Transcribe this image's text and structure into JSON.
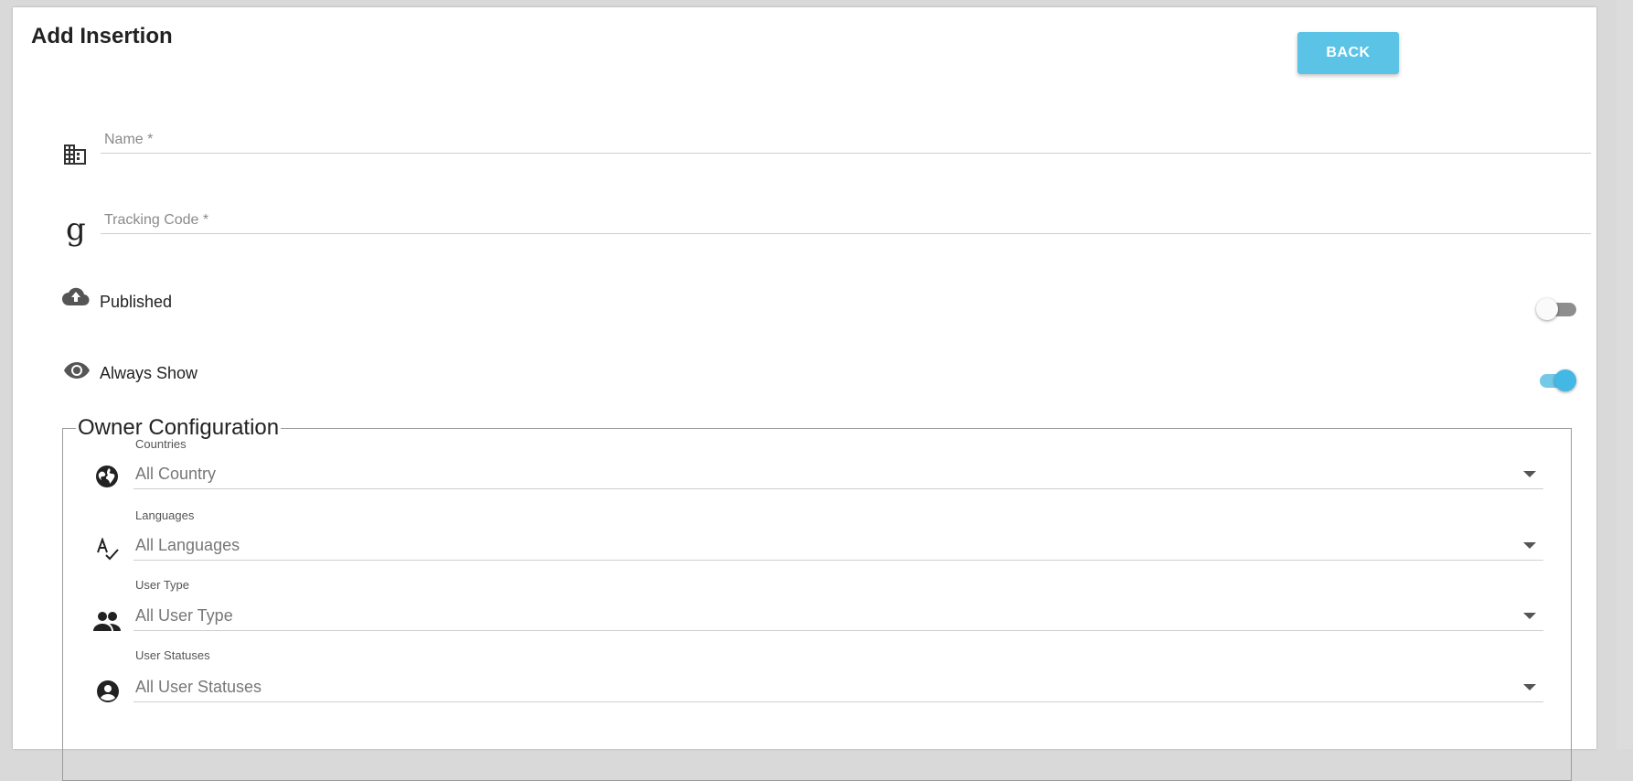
{
  "header": {
    "title": "Add Insertion",
    "back_label": "BACK"
  },
  "form": {
    "name_placeholder": "Name *",
    "tracking_placeholder": "Tracking Code *",
    "published_label": "Published",
    "published_on": false,
    "always_show_label": "Always Show",
    "always_show_on": true
  },
  "owner": {
    "legend": "Owner Configuration",
    "fields": [
      {
        "label": "Countries",
        "value": "All Country",
        "icon": "globe-icon"
      },
      {
        "label": "Languages",
        "value": "All Languages",
        "icon": "spellcheck-icon"
      },
      {
        "label": "User Type",
        "value": "All User Type",
        "icon": "people-icon"
      },
      {
        "label": "User Statuses",
        "value": "All User Statuses",
        "icon": "account-circle-icon"
      }
    ]
  },
  "colors": {
    "accent": "#5bc3e6",
    "toggle_on": "#43b8e4"
  }
}
